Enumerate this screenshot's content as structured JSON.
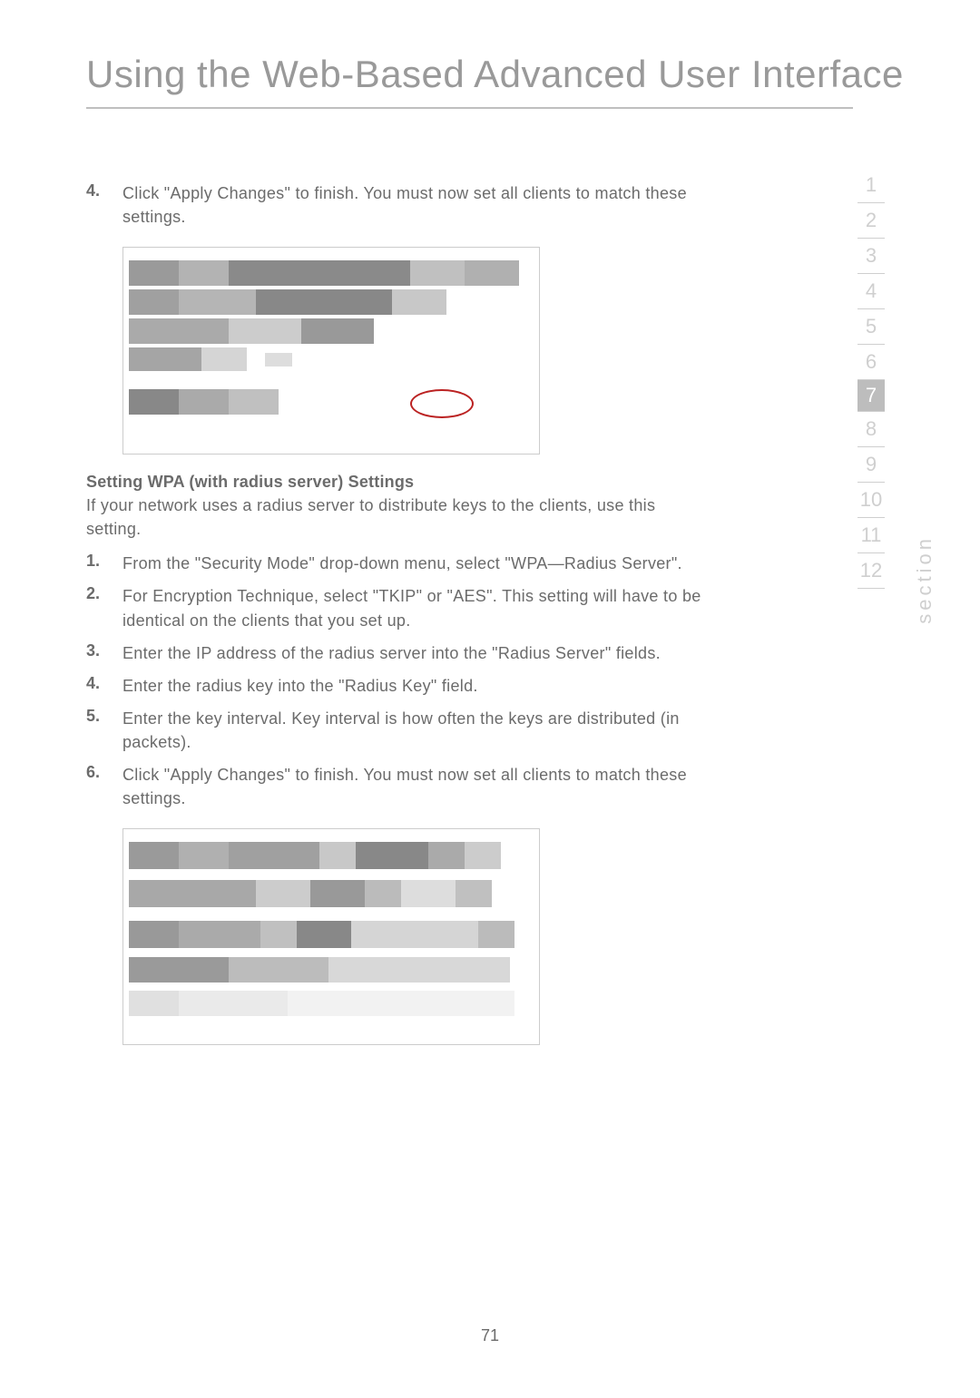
{
  "title": "Using the Web-Based Advanced User Interface",
  "intro_step": {
    "num": "4.",
    "text": "Click \"Apply Changes\" to finish. You must now set all clients to match these settings."
  },
  "subheading": "Setting WPA (with radius server) Settings",
  "subtext": "If your network uses a radius server to distribute keys to the clients, use this setting.",
  "steps": [
    {
      "num": "1.",
      "text": "From the \"Security Mode\" drop-down menu, select \"WPA—Radius Server\"."
    },
    {
      "num": "2.",
      "text": "For Encryption Technique, select \"TKIP\" or \"AES\". This setting will have to be identical on the clients that you set up."
    },
    {
      "num": "3.",
      "text": "Enter the IP address of the radius server into the \"Radius Server\" fields."
    },
    {
      "num": "4.",
      "text": "Enter the radius key into the \"Radius Key\" field."
    },
    {
      "num": "5.",
      "text": "Enter the key interval. Key interval is how often the keys are distributed (in packets)."
    },
    {
      "num": "6.",
      "text": "Click \"Apply Changes\" to finish. You must now set all clients to match these settings."
    }
  ],
  "nav": {
    "items": [
      "1",
      "2",
      "3",
      "4",
      "5",
      "6",
      "7",
      "8",
      "9",
      "10",
      "11",
      "12"
    ],
    "active": "7",
    "label": "section"
  },
  "page_number": "71"
}
